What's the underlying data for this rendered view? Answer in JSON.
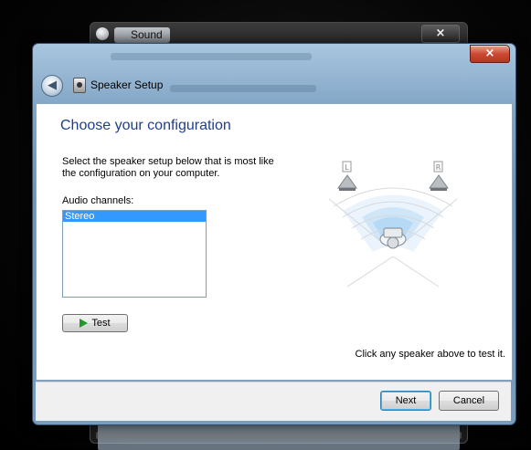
{
  "background_window": {
    "title": "Sound",
    "close_symbol": "×",
    "icon": "sound-icon"
  },
  "dialog": {
    "title": "Speaker Setup",
    "close_symbol": "×",
    "back_icon": "back-arrow-icon",
    "heading": "Choose your configuration",
    "description": "Select the speaker setup below that is most like the configuration on your computer.",
    "channels_label": "Audio channels:",
    "channels": [
      "Stereo"
    ],
    "selected_channel": "Stereo",
    "test_label": "Test",
    "hint": "Click any speaker above to test it.",
    "speaker_labels": {
      "left": "L",
      "right": "R"
    },
    "next_label": "Next",
    "cancel_label": "Cancel"
  },
  "colors": {
    "heading": "#1e3f8a",
    "selection": "#3399ff",
    "test_play": "#1f9a2a",
    "close_red": "#cc4a33"
  }
}
